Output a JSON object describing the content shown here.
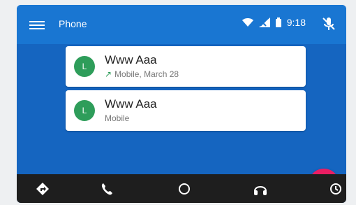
{
  "header": {
    "app_title": "Phone",
    "time": "9:18"
  },
  "calls": [
    {
      "avatar_letter": "L",
      "name": "Www Aaa",
      "detail": "Mobile, March 28",
      "direction_icon": "outgoing-call-arrow"
    },
    {
      "avatar_letter": "L",
      "name": "Www Aaa",
      "detail": "Mobile"
    }
  ],
  "colors": {
    "statusbar": "#1976d2",
    "background": "#1565c0",
    "avatar": "#2e9d5a",
    "fab": "#e91e63",
    "navbar": "#1e1e1e"
  },
  "nav": {
    "items": [
      "navigation-icon",
      "phone-icon",
      "home-circle-icon",
      "headphones-icon",
      "recent-icon"
    ]
  }
}
